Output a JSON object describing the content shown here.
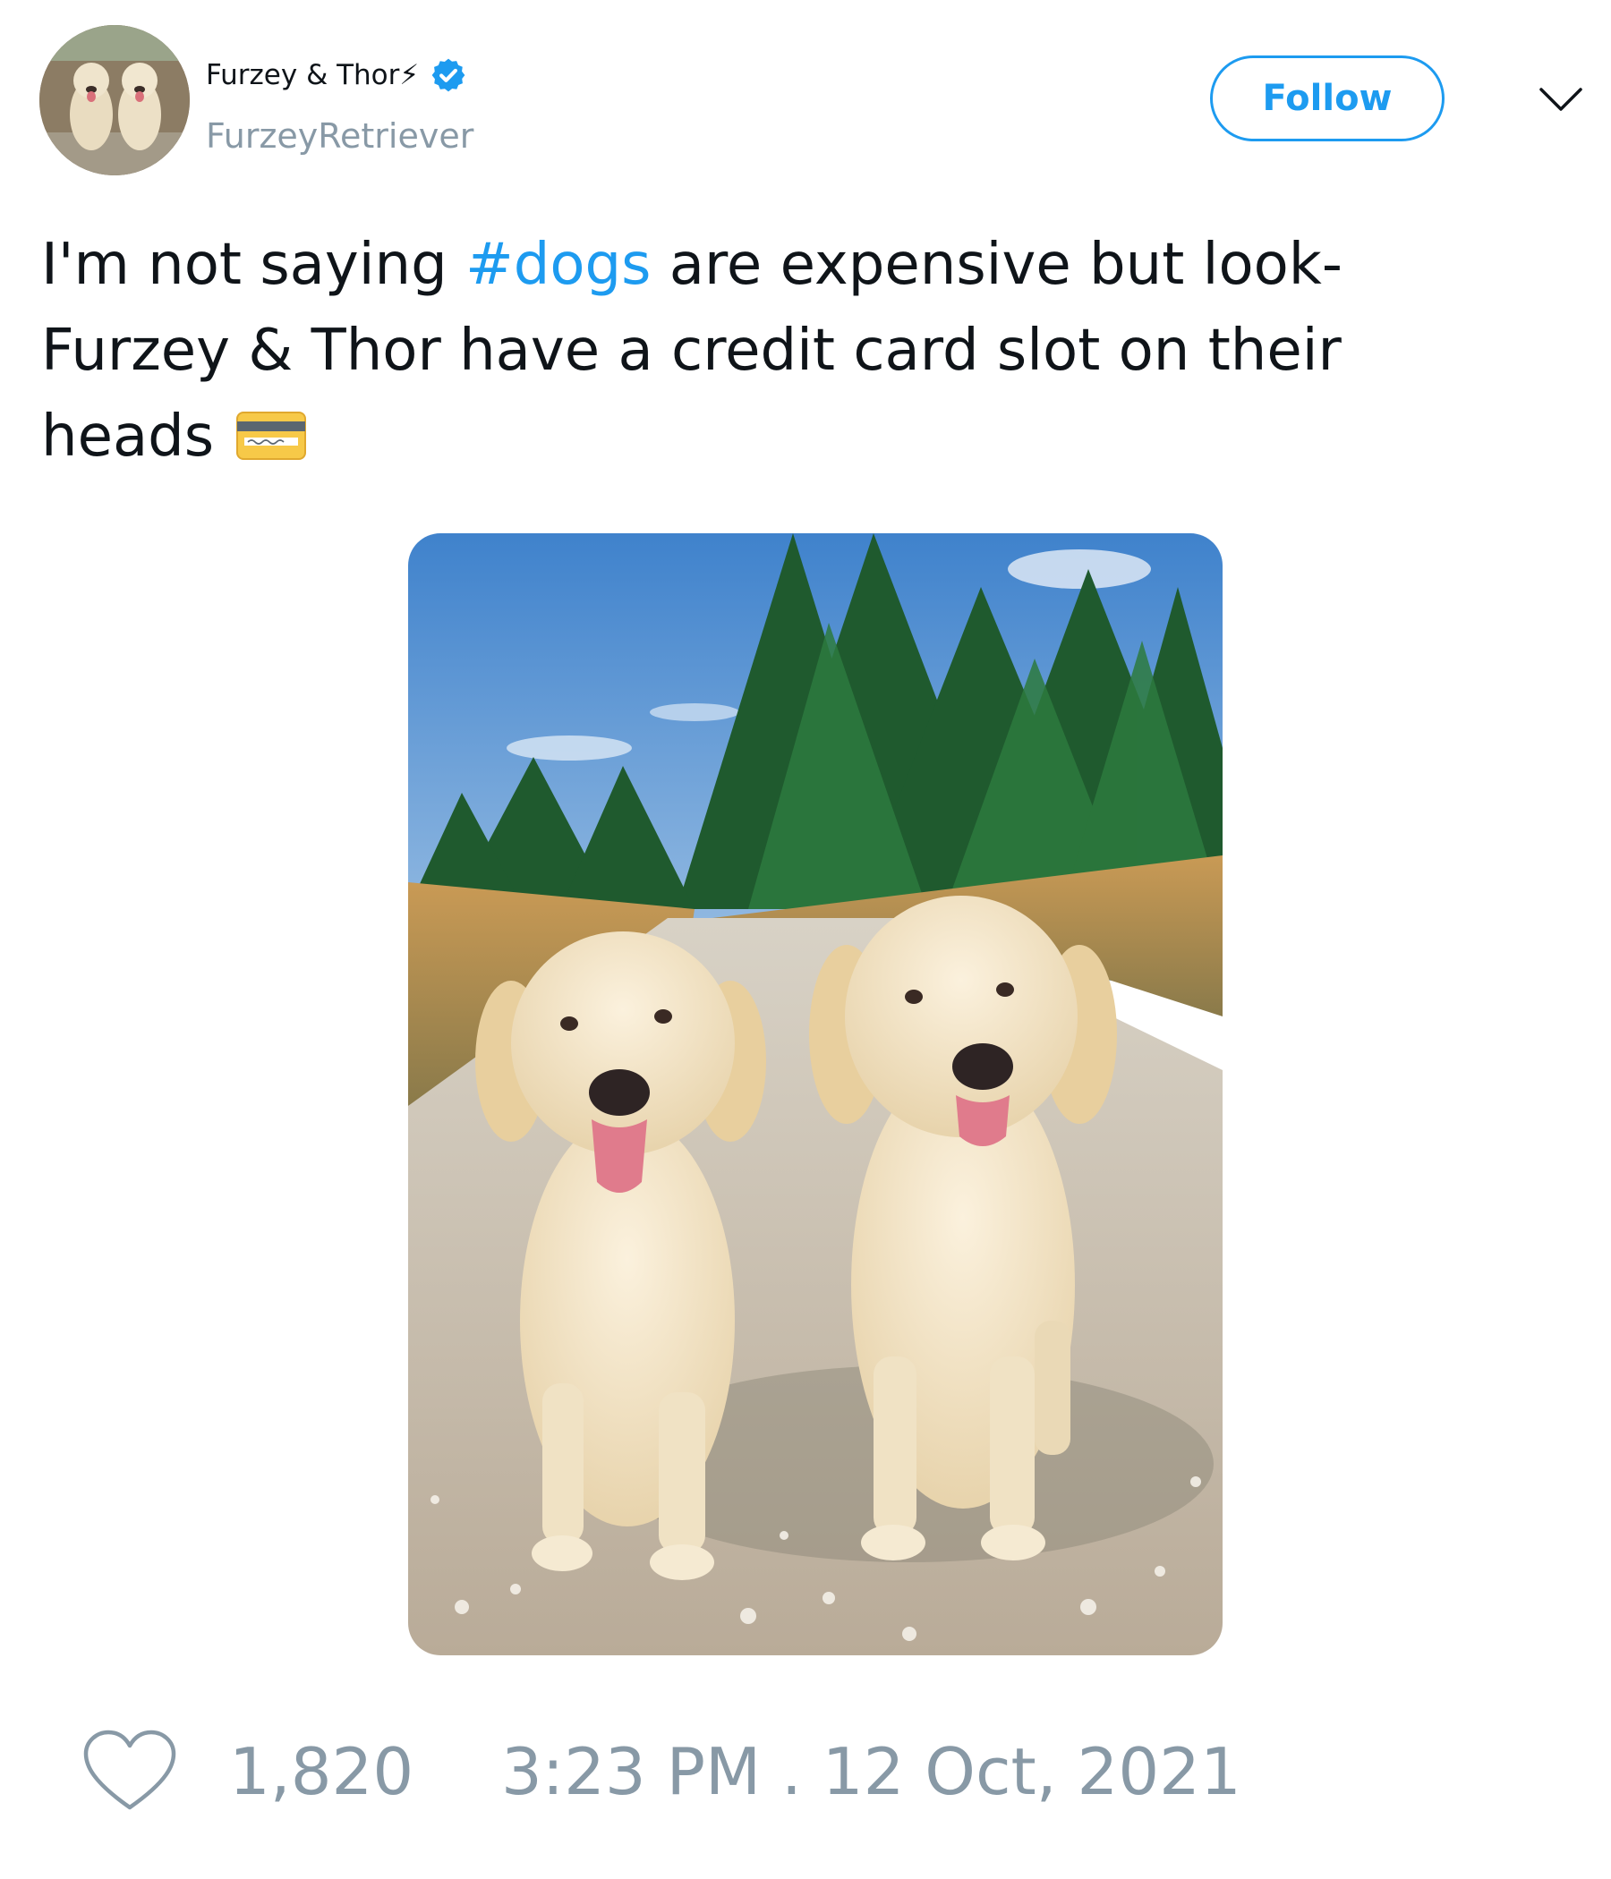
{
  "author": {
    "display_name": "Furzey & Thor⚡",
    "handle": "FurzeyRetriever",
    "verified": true
  },
  "header": {
    "follow_label": "Follow"
  },
  "tweet": {
    "text_line1_before": "I'm not saying ",
    "hashtag": "#dogs",
    "text_line1_after": " are expensive but look-",
    "text_line2": "Furzey & Thor have a credit card slot on their",
    "text_line3": "heads"
  },
  "footer": {
    "like_count": "1,820",
    "timestamp": "3:23 PM . 12 Oct, 2021"
  },
  "icons": {
    "verified": "verified-badge-icon",
    "menu": "chevron-down-icon",
    "emoji": "credit-card-icon",
    "like": "heart-icon"
  },
  "colors": {
    "accent": "#1d9bf0",
    "text": "#0f1419",
    "muted": "#8899a6"
  }
}
